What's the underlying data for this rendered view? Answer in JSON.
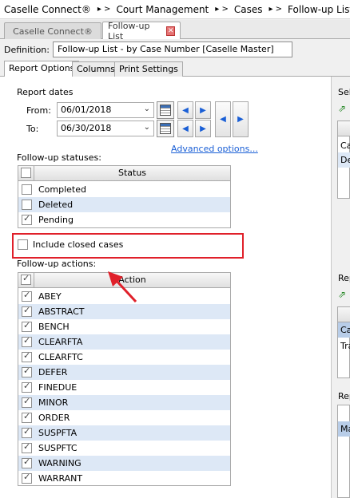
{
  "breadcrumb": [
    "Caselle Connect®",
    "Court Management",
    "Cases",
    "Follow-up List"
  ],
  "breadcrumb_separator": "▸  >",
  "tabs": [
    {
      "label": "Caselle Connect®",
      "active": false
    },
    {
      "label": "Follow-up List",
      "active": true,
      "close": "✕"
    }
  ],
  "definition": {
    "label": "Definition:",
    "value": "Follow-up List - by Case Number [Caselle Master]"
  },
  "subtabs": [
    {
      "label": "Report Options",
      "active": true
    },
    {
      "label": "Columns"
    },
    {
      "label": "Print Settings"
    }
  ],
  "report_dates": {
    "title": "Report dates",
    "from_label": "From:",
    "from_value": "06/01/2018",
    "to_label": "To:",
    "to_value": "06/30/2018",
    "advanced_link": "Advanced options..."
  },
  "followup_statuses": {
    "title": "Follow-up statuses:",
    "header": "Status",
    "items": [
      {
        "label": "Completed",
        "checked": false
      },
      {
        "label": "Deleted",
        "checked": false
      },
      {
        "label": "Pending",
        "checked": true
      }
    ]
  },
  "include_closed": {
    "label": "Include closed cases",
    "checked": false
  },
  "followup_actions": {
    "title": "Follow-up actions:",
    "header": "Action",
    "items": [
      {
        "label": "ABEY",
        "checked": true
      },
      {
        "label": "ABSTRACT",
        "checked": true
      },
      {
        "label": "BENCH",
        "checked": true
      },
      {
        "label": "CLEARFTA",
        "checked": true
      },
      {
        "label": "CLEARFTC",
        "checked": true
      },
      {
        "label": "DEFER",
        "checked": true
      },
      {
        "label": "FINEDUE",
        "checked": true
      },
      {
        "label": "MINOR",
        "checked": true
      },
      {
        "label": "ORDER",
        "checked": true
      },
      {
        "label": "SUSPFTA",
        "checked": true
      },
      {
        "label": "SUSPFTC",
        "checked": true
      },
      {
        "label": "WARNING",
        "checked": true
      },
      {
        "label": "WARRANT",
        "checked": true
      }
    ]
  },
  "right_panel": {
    "fragments": [
      "Sel",
      "Ca",
      "De",
      "Rep",
      "Ca",
      "Tra",
      "Rep",
      "Ma"
    ]
  },
  "colors": {
    "highlight_box": "#e0202a",
    "link": "#1a5fd6",
    "row_alt": "#dde8f6"
  }
}
